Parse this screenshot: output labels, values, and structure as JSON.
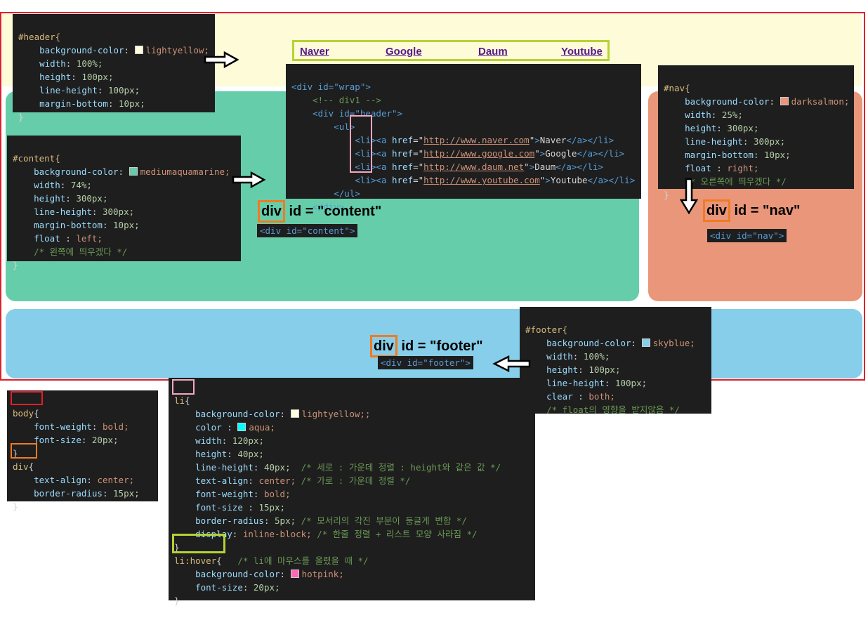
{
  "colors": {
    "frame": "#e0202a",
    "header_bg": "#fdfbd8",
    "content_bg": "#66cdaa",
    "nav_bg": "#e9967a",
    "footer_bg": "#87ceeb",
    "code_bg": "#1e1e1e",
    "highlight_orange": "#f07b21",
    "highlight_pink": "#f4a7c0",
    "highlight_green": "#b5d334",
    "highlight_red": "#e0202a"
  },
  "nav_links": [
    "Naver",
    "Google",
    "Daum",
    "Youtube"
  ],
  "header_css": {
    "selector": "#header{",
    "lines": [
      {
        "p": "background-color",
        "swatch": "#ffffe0",
        "v": "lightyellow;"
      },
      {
        "p": "width",
        "v": "100%;"
      },
      {
        "p": "height",
        "v": "100px;"
      },
      {
        "p": "line-height",
        "v": "100px;"
      },
      {
        "p": "margin-bottom",
        "v": "10px;"
      }
    ],
    "close": "}"
  },
  "content_css": {
    "selector": "#content{",
    "lines": [
      {
        "p": "background-color",
        "swatch": "#66cdaa",
        "v": "mediumaquamarine;"
      },
      {
        "p": "width",
        "v": "74%;"
      },
      {
        "p": "height",
        "v": "300px;"
      },
      {
        "p": "line-height",
        "v": "300px;"
      },
      {
        "p": "margin-bottom",
        "v": "10px;"
      },
      {
        "p": "float ",
        "v": "left;"
      }
    ],
    "comment": "/* 왼쪽에 띄우겠다 */",
    "close": "}"
  },
  "nav_css": {
    "selector": "#nav{",
    "lines": [
      {
        "p": "background-color",
        "swatch": "#e9967a",
        "v": "darksalmon;"
      },
      {
        "p": "width",
        "v": "25%;"
      },
      {
        "p": "height",
        "v": "300px;"
      },
      {
        "p": "line-height",
        "v": "300px;"
      },
      {
        "p": "margin-bottom",
        "v": "10px;"
      },
      {
        "p": "float ",
        "v": "right;"
      }
    ],
    "comment": "/* 오른쪽에 띄우겠다 */",
    "close": "}"
  },
  "footer_css": {
    "selector": "#footer{",
    "lines": [
      {
        "p": "background-color",
        "swatch": "#87ceeb",
        "v": "skyblue;"
      },
      {
        "p": "width",
        "v": "100%;"
      },
      {
        "p": "height",
        "v": "100px;"
      },
      {
        "p": "line-height",
        "v": "100px;"
      },
      {
        "p": "clear ",
        "v": "both;"
      }
    ],
    "comment": "/* float의 영향을 받지않음 */",
    "close": ""
  },
  "body_css": {
    "body_selector": "body",
    "body_brace": "{",
    "body_lines": [
      {
        "p": "font-weight",
        "v": "bold;"
      },
      {
        "p": "font-size",
        "v": "20px;"
      }
    ],
    "div_selector": "div",
    "div_brace": "{",
    "div_lines": [
      {
        "p": "text-align",
        "v": "center;"
      },
      {
        "p": "border-radius",
        "v": "15px;"
      }
    ],
    "close": "}"
  },
  "li_css": {
    "li_selector": "li",
    "li_brace": "{",
    "li_lines": [
      {
        "p": "background-color",
        "swatch": "#ffffe0",
        "v": "lightyellow;;",
        "c": ""
      },
      {
        "p": "color ",
        "swatch": "#00ffff",
        "v": "aqua;",
        "c": ""
      },
      {
        "p": "width",
        "v": "120px;",
        "c": ""
      },
      {
        "p": "height",
        "v": "40px;",
        "c": ""
      },
      {
        "p": "line-height",
        "v": "40px;",
        "c": "  /* 세로 : 가운데 정렬 : height와 같은 값 */"
      },
      {
        "p": "text-align",
        "v": "center;",
        "c": " /* 가로 : 가운데 정렬 */"
      },
      {
        "p": "font-weight",
        "v": "bold;",
        "c": ""
      },
      {
        "p": "font-size ",
        "v": "15px;",
        "c": ""
      },
      {
        "p": "border-radius",
        "v": "5px;",
        "c": " /* 모서리의 각진 부분이 둥글게 변함 */"
      },
      {
        "p": "display",
        "v": "inline-block;",
        "c": " /* 한줄 정렬 + 리스트 모양 사라짐 */"
      }
    ],
    "hover_selector": "li:hover",
    "hover_brace": "{",
    "hover_comment": "/* li에 마우스를 올렸을 때 */",
    "hover_lines": [
      {
        "p": "background-color",
        "swatch": "#ff69b4",
        "v": "hotpink;"
      },
      {
        "p": "font-size",
        "v": "20px;"
      }
    ],
    "close": "}"
  },
  "html_code": {
    "wrap_open": "<div id=\"wrap\">",
    "comment": "<!-- div1 -->",
    "header_open": "<div id=\"header\">",
    "ul_open": "<ul>",
    "items": [
      {
        "url": "http://www.naver.com",
        "label": "Naver"
      },
      {
        "url": "http://www.google.com",
        "label": "Google"
      },
      {
        "url": "http://www.daum.net",
        "label": "Daum"
      },
      {
        "url": "http://www.youtube.com",
        "label": "Youtube"
      }
    ],
    "ul_close": "</ul>",
    "div_close": "</div>"
  },
  "labels": {
    "content_label_div": "div",
    "content_label_rest": " id = \"content\"",
    "content_tag": "<div id=\"content\">",
    "nav_label_div": "div",
    "nav_label_rest": " id = \"nav\"",
    "nav_tag": "<div id=\"nav\">",
    "footer_label_div": "div",
    "footer_label_rest": " id = \"footer\"",
    "footer_tag": "<div id=\"footer\">"
  }
}
